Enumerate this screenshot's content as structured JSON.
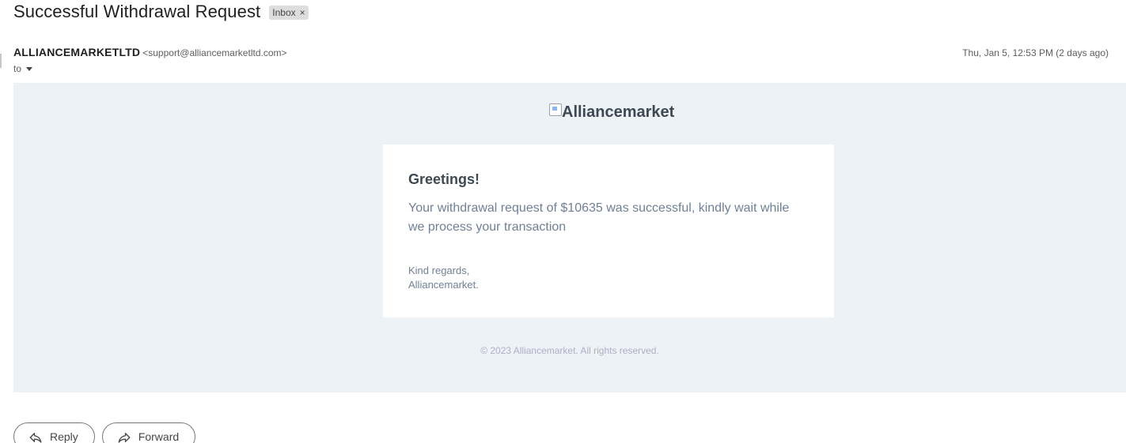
{
  "subject": "Successful Withdrawal Request",
  "label": {
    "text": "Inbox",
    "close": "×"
  },
  "sender": {
    "name": "ALLIANCEMARKETLTD",
    "email": "<support@alliancemarketltd.com>",
    "to_label": "to",
    "date": "Thu, Jan 5, 12:53 PM (2 days ago)"
  },
  "email": {
    "logo_alt": "Alliancemarket",
    "greeting": "Greetings!",
    "message": "Your withdrawal request of $10635 was successful, kindly wait while we process your transaction",
    "regards_line1": "Kind regards,",
    "regards_line2": "Alliancemarket.",
    "footer": "© 2023 Alliancemarket. All rights reserved.",
    "colors": {
      "background": "#edf2f7",
      "heading": "#3d4852",
      "text": "#718096"
    }
  },
  "actions": {
    "reply": {
      "label": "Reply",
      "icon": "reply-icon"
    },
    "forward": {
      "label": "Forward",
      "icon": "forward-icon"
    }
  }
}
